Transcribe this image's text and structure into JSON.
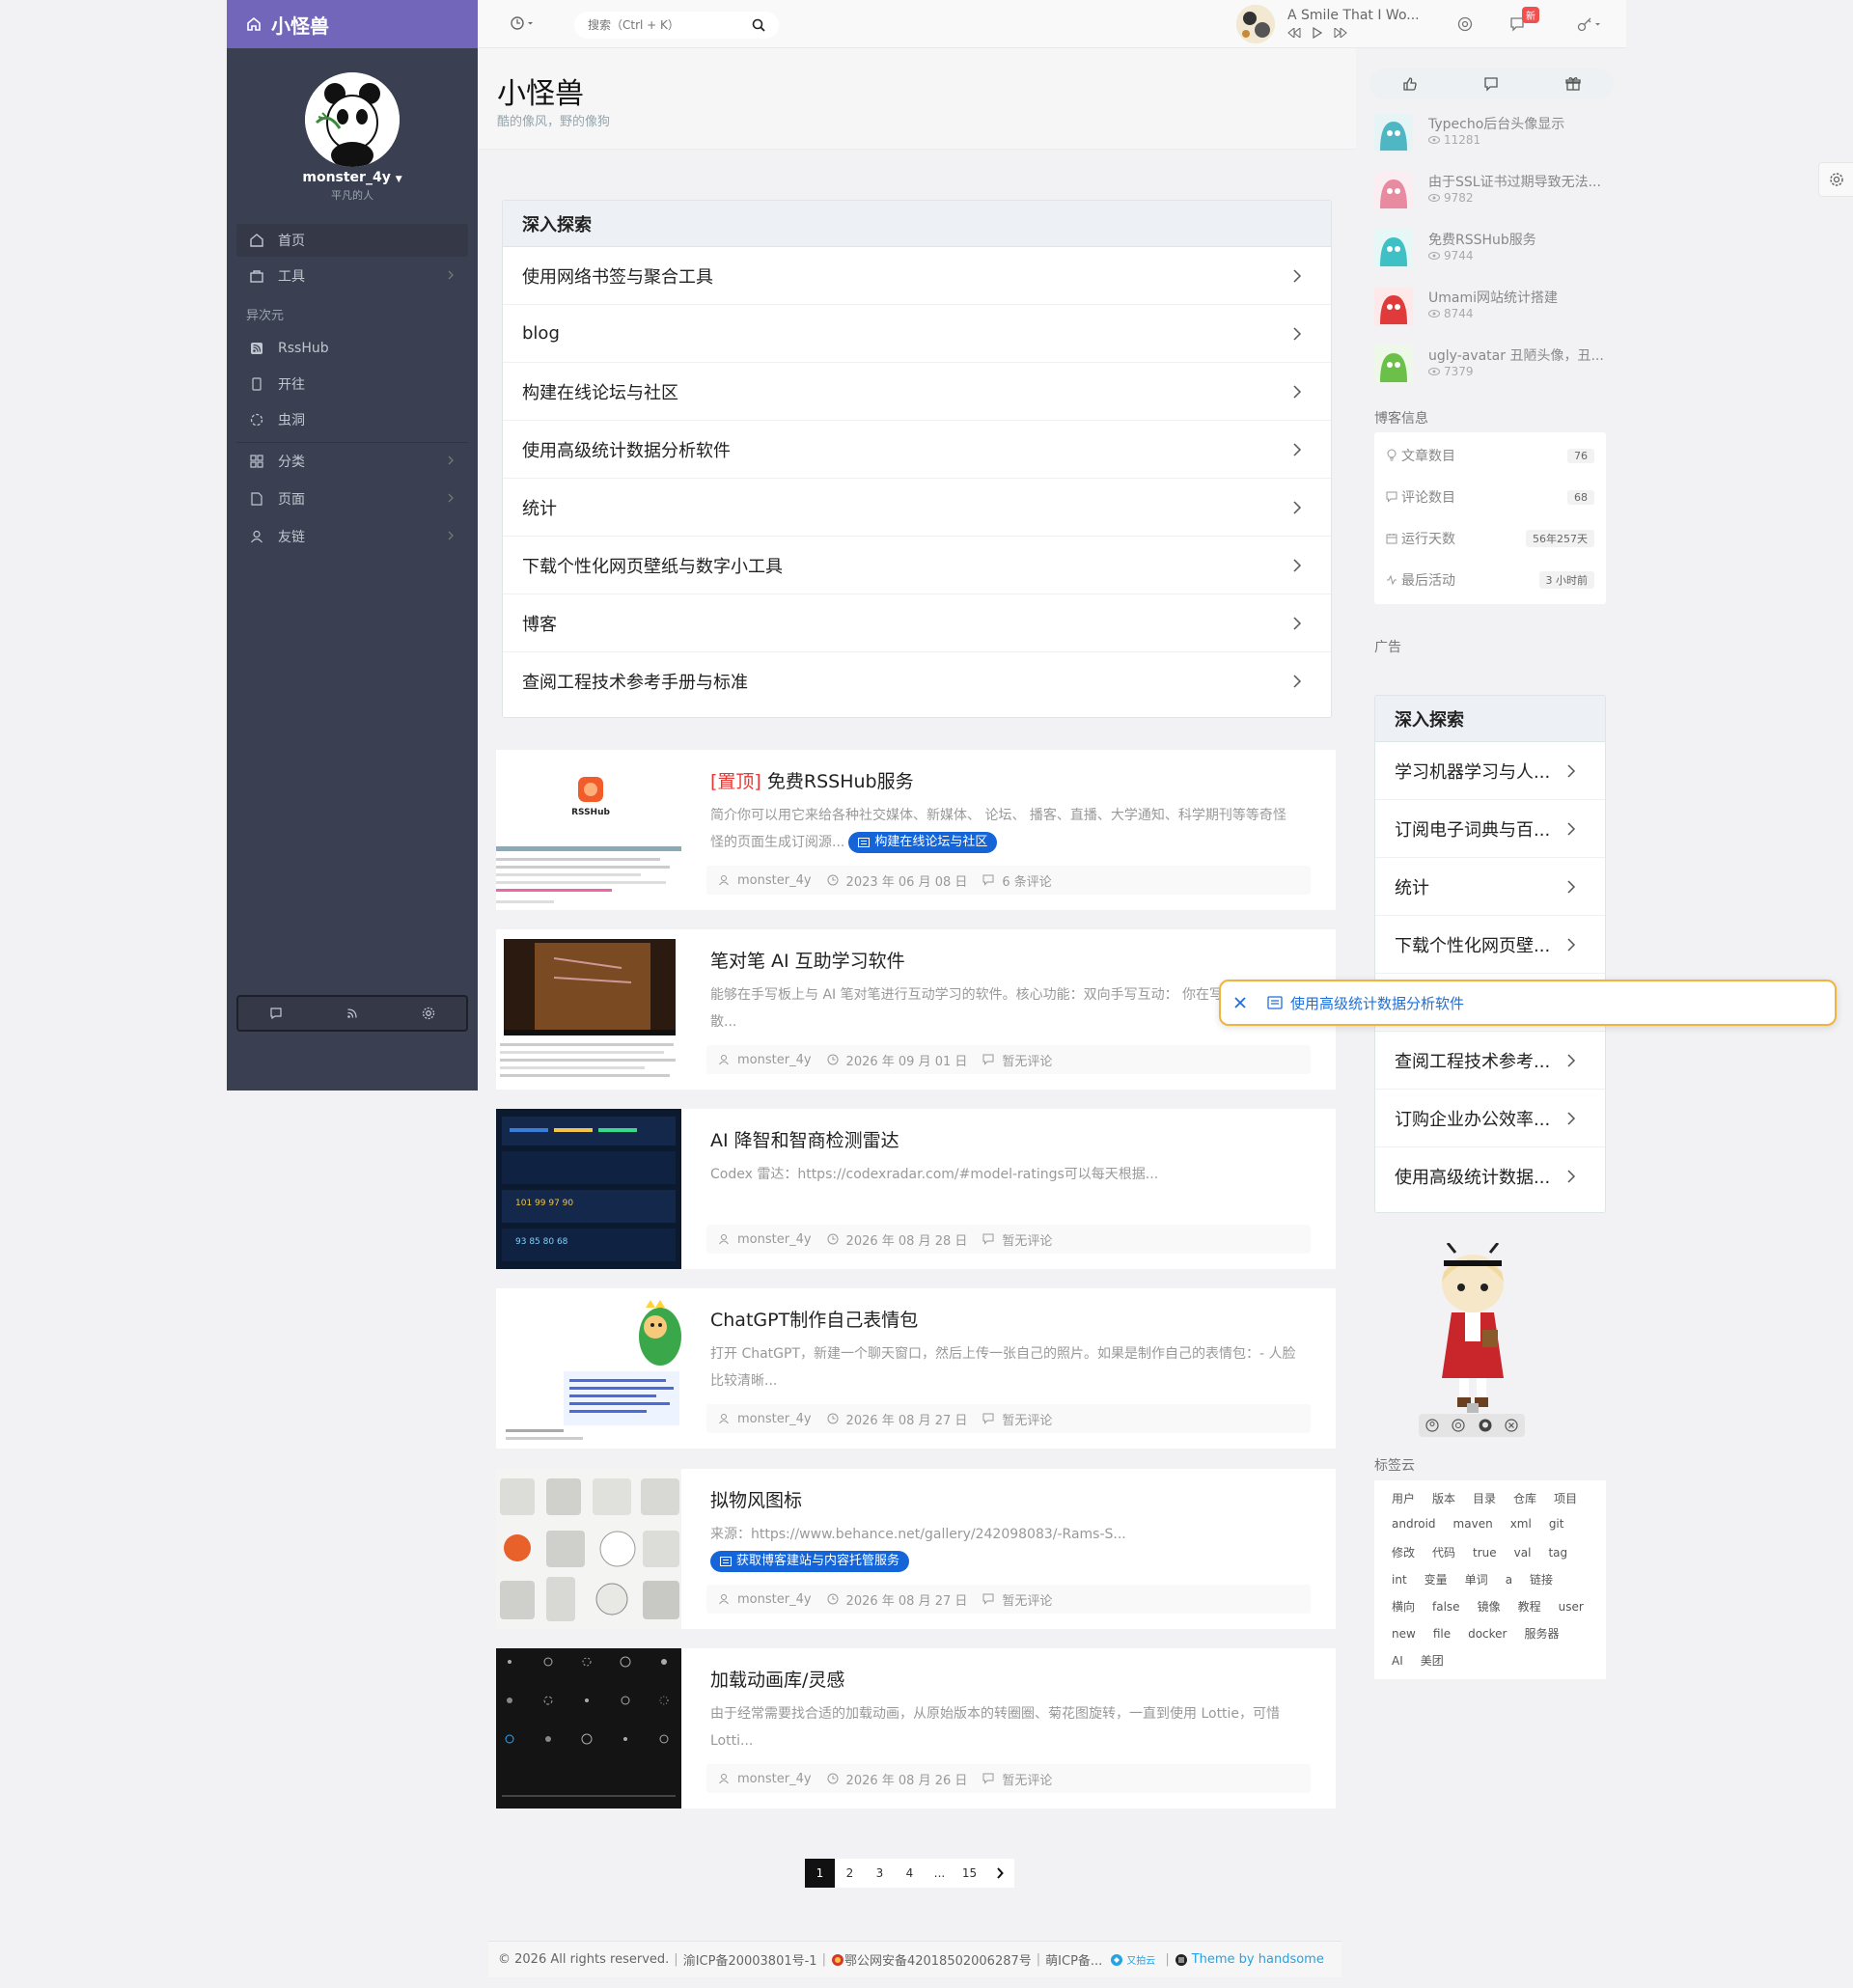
{
  "brand": {
    "title": "小怪兽"
  },
  "profile": {
    "username": "monster_4y",
    "motto": "平凡的人"
  },
  "nav": {
    "items": [
      {
        "label": "首页",
        "icon": "home-icon"
      },
      {
        "label": "工具",
        "icon": "toolbox-icon"
      }
    ],
    "section": "异次元",
    "sub_items": [
      {
        "label": "RssHub",
        "icon": "rss-icon"
      },
      {
        "label": "开往",
        "icon": "train-icon"
      },
      {
        "label": "虫洞",
        "icon": "wormhole-icon"
      }
    ],
    "more_items": [
      {
        "label": "分类",
        "icon": "grid-icon"
      },
      {
        "label": "页面",
        "icon": "page-icon"
      },
      {
        "label": "友链",
        "icon": "user-icon"
      }
    ]
  },
  "header": {
    "search_placeholder": "搜索（Ctrl + K）",
    "music_title": "A Smile That I Wo...",
    "badge": "新"
  },
  "page": {
    "title": "小怪兽",
    "subtitle": "酷的像风，野的像狗"
  },
  "explore": {
    "title": "深入探索",
    "rows": [
      "使用网络书签与聚合工具",
      "blog",
      "构建在线论坛与社区",
      "使用高级统计数据分析软件",
      "统计",
      "下载个性化网页壁纸与数字小工具",
      "博客",
      "查阅工程技术参考手册与标准"
    ]
  },
  "posts": [
    {
      "pin": "[置顶]",
      "title": "免费RSSHub服务",
      "excerpt": "简介你可以用它来给各种社交媒体、新媒体、 论坛、 播客、直播、大学通知、科学期刊等等奇怪怪的页面生成订阅源...",
      "tag": "构建在线论坛与社区",
      "author": "monster_4y",
      "date": "2023 年 06 月 08 日",
      "comments": "6 条评论"
    },
    {
      "pin": "",
      "title": "笔对笔 AI 互助学习软件",
      "excerpt": "能够在手写板上与 AI 笔对笔进行互动学习的软件。核心功能：双向手写互动： 你在写记录、发散...",
      "tag": "",
      "author": "monster_4y",
      "date": "2026 年 09 月 01 日",
      "comments": "暂无评论"
    },
    {
      "pin": "",
      "title": "AI 降智和智商检测雷达",
      "excerpt": "Codex 雷达：https://codexradar.com/#model-ratings可以每天根据...",
      "tag": "",
      "author": "monster_4y",
      "date": "2026 年 08 月 28 日",
      "comments": "暂无评论"
    },
    {
      "pin": "",
      "title": "ChatGPT制作自己表情包",
      "excerpt": "打开 ChatGPT，新建一个聊天窗口，然后上传一张自己的照片。如果是制作自己的表情包：- 人脸比较清晰...",
      "tag": "",
      "author": "monster_4y",
      "date": "2026 年 08 月 27 日",
      "comments": "暂无评论"
    },
    {
      "pin": "",
      "title": "拟物风图标",
      "excerpt": "来源：https://www.behance.net/gallery/242098083/-Rams-S...",
      "tag": "获取博客建站与内容托管服务",
      "author": "monster_4y",
      "date": "2026 年 08 月 27 日",
      "comments": "暂无评论"
    },
    {
      "pin": "",
      "title": "加载动画库/灵感",
      "excerpt": "由于经常需要找合适的加载动画，从原始版本的转圈圈、菊花图旋转，一直到使用 Lottie，可惜Lotti...",
      "tag": "",
      "author": "monster_4y",
      "date": "2026 年 08 月 26 日",
      "comments": "暂无评论"
    }
  ],
  "post_thumb_labels": {
    "rss": "RSSHub"
  },
  "pagination": [
    "1",
    "2",
    "3",
    "4",
    "...",
    "15"
  ],
  "footer": {
    "copyright": "© 2026 All rights reserved.",
    "icp": "渝ICP备20003801号-1",
    "police": "鄂公网安备42018502006287号",
    "moe": "萌ICP备...",
    "cloud": "又拍云",
    "theme": "Theme by handsome"
  },
  "hot": [
    {
      "title": "Typecho后台头像显示",
      "views": "11281",
      "color": "#4fb6c4"
    },
    {
      "title": "由于SSL证书过期导致无法...",
      "views": "9782",
      "color": "#e88aa0"
    },
    {
      "title": "免费RSSHub服务",
      "views": "9744",
      "color": "#3fc0c4"
    },
    {
      "title": "Umami网站统计搭建",
      "views": "8744",
      "color": "#e03a3a"
    },
    {
      "title": "ugly-avatar 丑陋头像，丑...",
      "views": "7379",
      "color": "#6bc04a"
    }
  ],
  "blog_info": {
    "title": "博客信息",
    "rows": [
      {
        "label": "文章数目",
        "value": "76"
      },
      {
        "label": "评论数目",
        "value": "68"
      },
      {
        "label": "运行天数",
        "value": "56年257天"
      },
      {
        "label": "最后活动",
        "value": "3 小时前"
      }
    ]
  },
  "ad_label": "广告",
  "right_explore": {
    "title": "深入探索",
    "rows": [
      "学习机器学习与人...",
      "订阅电子词典与百...",
      "统计",
      "下载个性化网页壁...",
      "",
      "查阅工程技术参考...",
      "订购企业办公效率...",
      "使用高级统计数据..."
    ]
  },
  "toast": {
    "text": "使用高级统计数据分析软件"
  },
  "tag_cloud": {
    "title": "标签云",
    "lines": [
      [
        "用户",
        "版本",
        "目录",
        "仓库",
        "项目"
      ],
      [
        "android",
        "maven",
        "xml",
        "git"
      ],
      [
        "修改",
        "代码",
        "true",
        "val",
        "tag"
      ],
      [
        "int",
        "变量",
        "单词",
        "a",
        "链接"
      ],
      [
        "横向",
        "false",
        "镜像",
        "教程",
        "user"
      ],
      [
        "new",
        "file",
        "docker",
        "服务器"
      ],
      [
        "AI",
        "美团"
      ]
    ]
  },
  "colors": {
    "brand": "#7266ba",
    "sidebar": "#3a3f51",
    "accent_blue": "#1565d8",
    "pin_red": "#e53935"
  }
}
